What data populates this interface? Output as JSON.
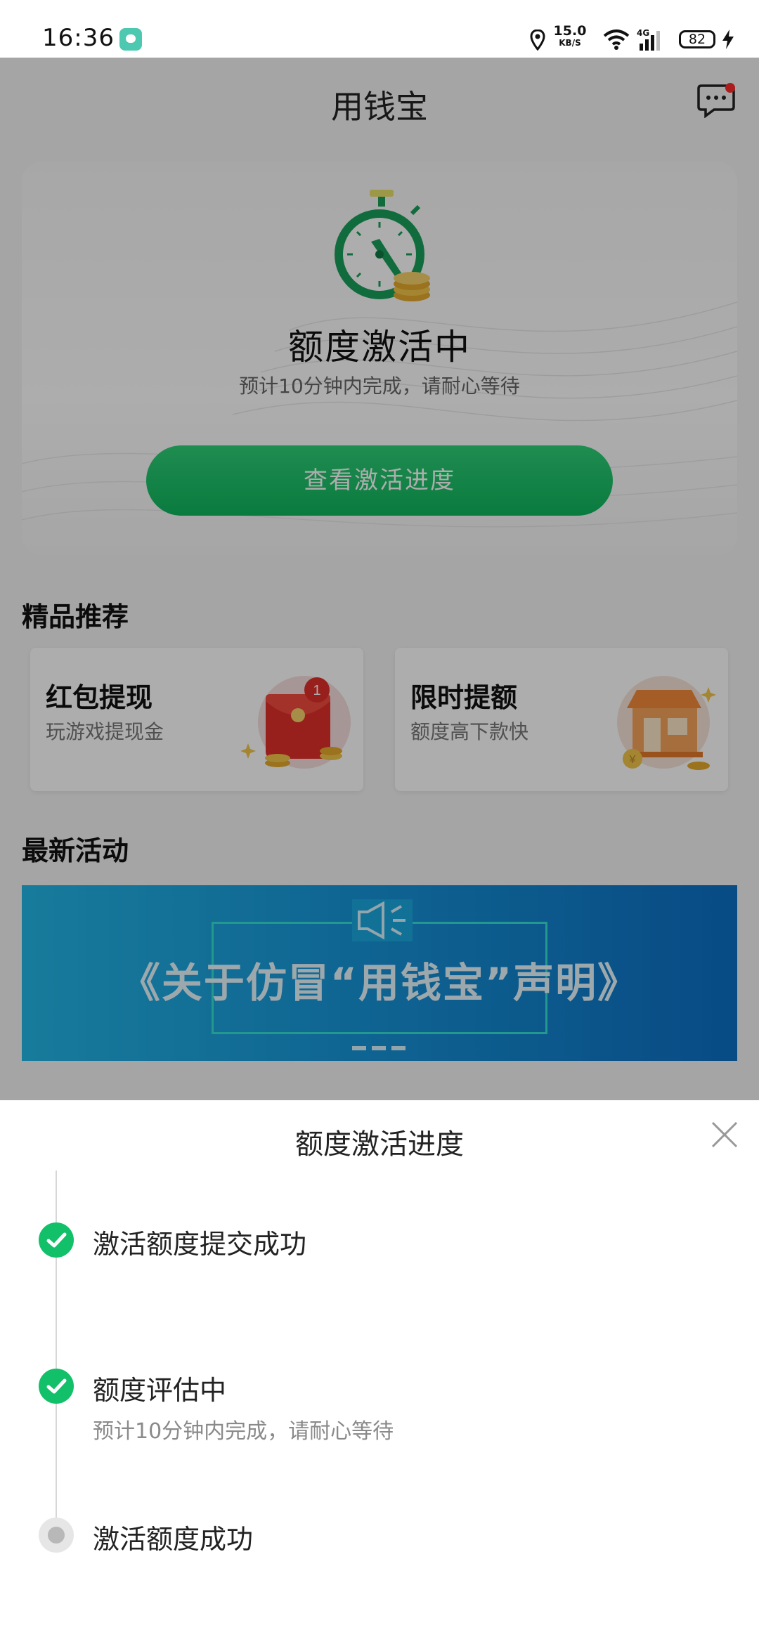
{
  "status_bar": {
    "time": "16:36",
    "network_speed": "15.0",
    "speed_unit": "KB/S",
    "network_type": "4G",
    "battery": "82"
  },
  "header": {
    "title": "用钱宝"
  },
  "activation": {
    "title": "额度激活中",
    "subtitle": "预计10分钟内完成，请耐心等待",
    "button_label": "查看激活进度"
  },
  "recommend": {
    "section_title": "精品推荐",
    "cards": [
      {
        "title": "红包提现",
        "subtitle": "玩游戏提现金",
        "badge": "1"
      },
      {
        "title": "限时提额",
        "subtitle": "额度高下款快"
      }
    ]
  },
  "activities": {
    "section_title": "最新活动",
    "banner_text": "《关于仿冒“用钱宝”声明》"
  },
  "sheet": {
    "title": "额度激活进度",
    "steps": [
      {
        "title": "激活额度提交成功",
        "status": "done"
      },
      {
        "title": "额度评估中",
        "subtitle": "预计10分钟内完成，请耐心等待",
        "status": "done"
      },
      {
        "title": "激活额度成功",
        "status": "pending"
      }
    ]
  },
  "colors": {
    "accent_green": "#12c06a",
    "notice_red": "#ff2a2a"
  }
}
